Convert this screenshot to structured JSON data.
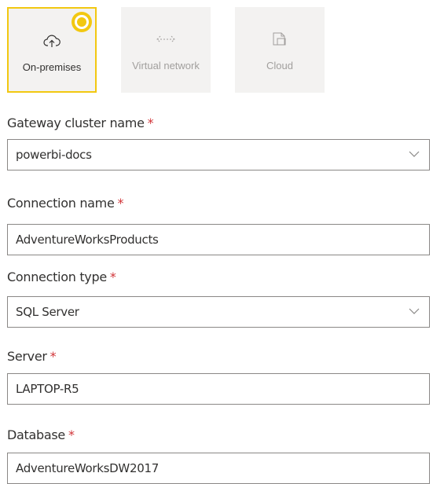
{
  "location_tiles": [
    {
      "label": "On-premises",
      "icon": "cloud-upload-icon",
      "state": "selected"
    },
    {
      "label": "Virtual network",
      "icon": "arrows-left-right-icon",
      "state": "disabled"
    },
    {
      "label": "Cloud",
      "icon": "cloud-document-icon",
      "state": "disabled"
    }
  ],
  "form": {
    "gateway_cluster_name": {
      "label": "Gateway cluster name",
      "required_mark": "*",
      "value": "powerbi-docs",
      "type": "dropdown"
    },
    "connection_name": {
      "label": "Connection name",
      "required_mark": "*",
      "value": "AdventureWorksProducts",
      "type": "text"
    },
    "connection_type": {
      "label": "Connection type",
      "required_mark": "*",
      "value": "SQL Server",
      "type": "dropdown"
    },
    "server": {
      "label": "Server",
      "required_mark": "*",
      "value": "LAPTOP-R5",
      "type": "text"
    },
    "database": {
      "label": "Database",
      "required_mark": "*",
      "value": "AdventureWorksDW2017",
      "type": "text"
    }
  },
  "colors": {
    "accent": "#f2c811",
    "required": "#d13438",
    "tile_bg": "#f3f2f1",
    "border": "#8a8886",
    "disabled_text": "#a19f9d"
  }
}
